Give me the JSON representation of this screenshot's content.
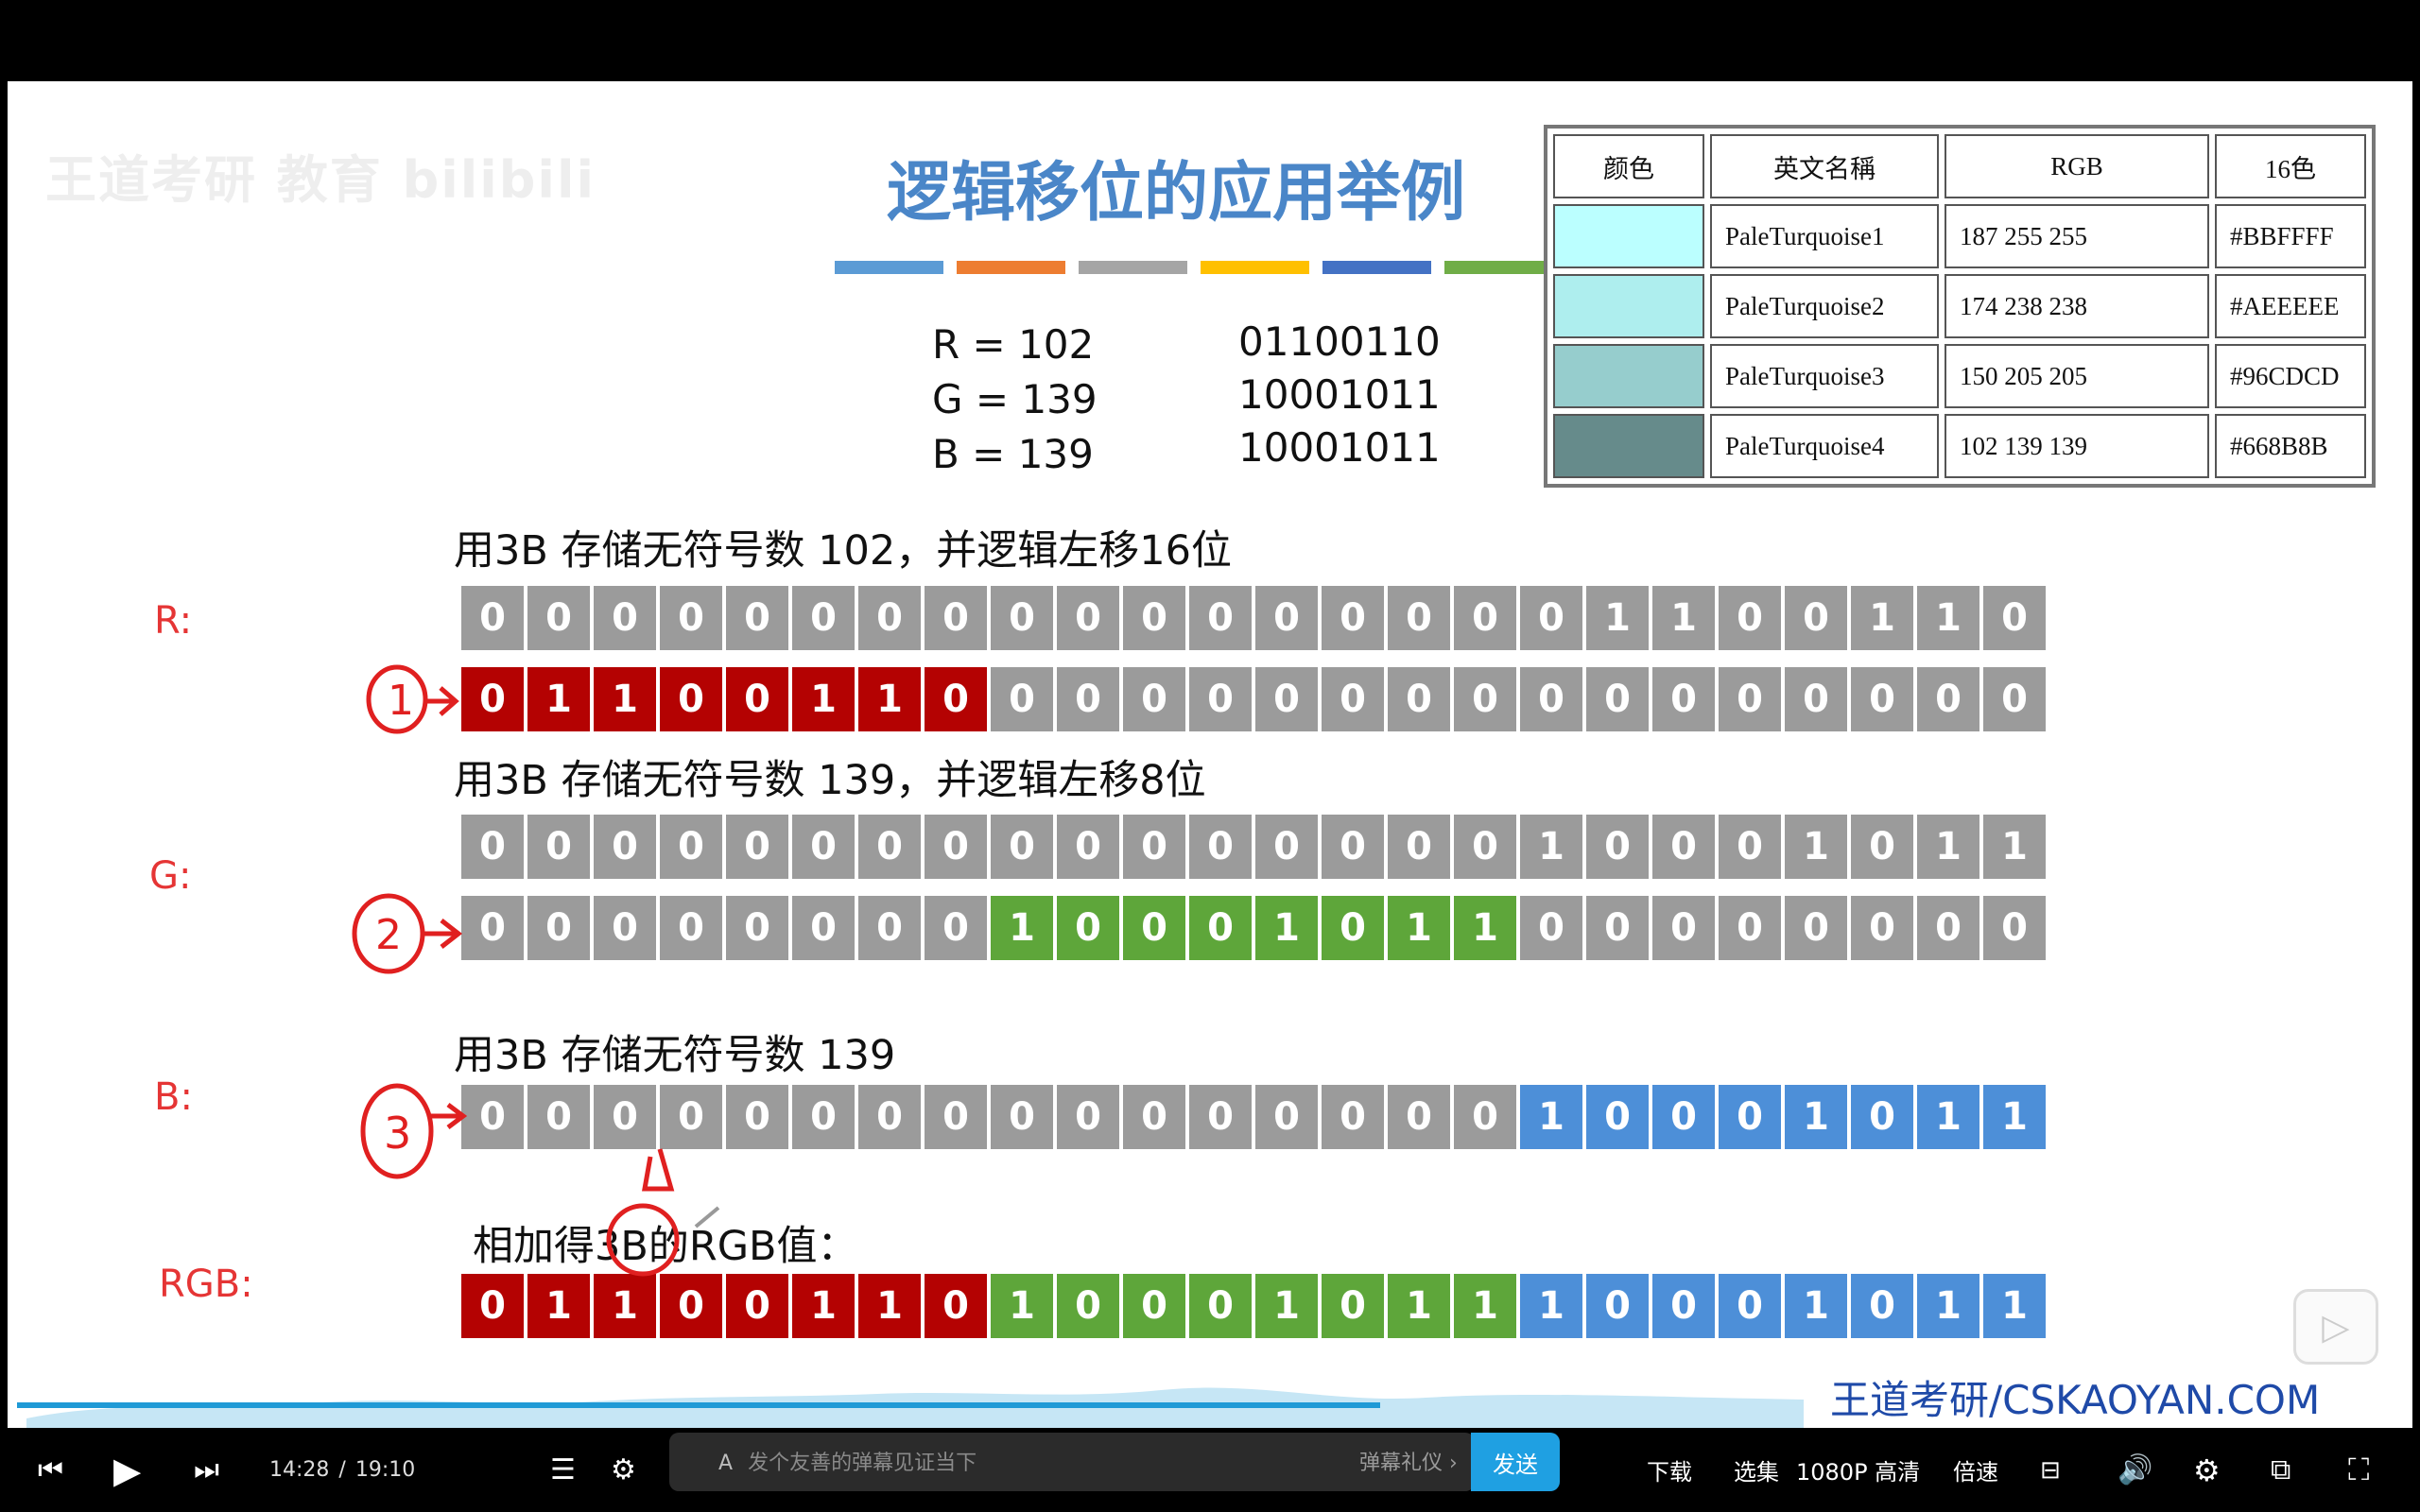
{
  "slide": {
    "watermark": "王道考研 教育 bilibili",
    "title": "逻辑移位的应用举例",
    "color_bar_colors": [
      "#5b9bd5",
      "#ed7d31",
      "#a5a5a5",
      "#ffc000",
      "#4472c4",
      "#70ad47"
    ],
    "rgb_decimal": [
      "R = 102",
      "G = 139",
      "B = 139"
    ],
    "rgb_binary": [
      "01100110",
      "10001011",
      "10001011"
    ],
    "color_table": {
      "headers": [
        "颜色",
        "英文名稱",
        "RGB",
        "16色"
      ],
      "rows": [
        {
          "swatch": "#BBFFFF",
          "name": "PaleTurquoise1",
          "rgb": "187 255 255",
          "hex": "#BBFFFF"
        },
        {
          "swatch": "#AEEEEE",
          "name": "PaleTurquoise2",
          "rgb": "174 238 238",
          "hex": "#AEEEEE"
        },
        {
          "swatch": "#96CDCD",
          "name": "PaleTurquoise3",
          "rgb": "150 205 205",
          "hex": "#96CDCD"
        },
        {
          "swatch": "#668B8B",
          "name": "PaleTurquoise4",
          "rgb": "102 139 139",
          "hex": "#668B8B"
        }
      ]
    },
    "captions": {
      "r": "用3B 存储无符号数 102，并逻辑左移16位",
      "g": "用3B 存储无符号数 139，并逻辑左移8位",
      "b": "用3B 存储无符号数 139",
      "sum": "相加得3B的RGB值："
    },
    "labels": {
      "r": "R:",
      "g": "G:",
      "b": "B:",
      "rgb": "RGB:"
    },
    "annotations": {
      "step1": "1",
      "step2": "2",
      "step3": "3"
    },
    "bit_rows": {
      "r_before": {
        "bits": "000000000000000001100110",
        "colors": "gggggggggggggggggggggggg"
      },
      "r_after": {
        "bits": "011001100000000000000000",
        "colors": "rrrrrrrrgggggggggggggggg"
      },
      "g_before": {
        "bits": "000000000000000010001011",
        "colors": "gggggggggggggggggggggggg"
      },
      "g_after": {
        "bits": "000000001000101100000000",
        "colors": "ggggggggeeeeeeeegggggggg"
      },
      "b_row": {
        "bits": "000000000000000010001011",
        "colors": "ggggggggggggggggbbbbbbbb"
      },
      "rgb_sum": {
        "bits": "011001101000101110001011",
        "colors": "rrrrrrrreeeeeeeebbbbbbbb"
      }
    },
    "brand": "王道考研/CSKAOYAN.COM"
  },
  "player": {
    "current_time": "14:28",
    "separator": "/",
    "total_time": "19:10",
    "danmu_placeholder": "发个友善的弹幕见证当下",
    "danmu_etiquette": "弹幕礼仪 ›",
    "send_label": "发送",
    "download_label": "下载",
    "episodes_label": "选集",
    "quality_label": "1080P 高清",
    "speed_label": "倍速",
    "progress": 0.755
  }
}
